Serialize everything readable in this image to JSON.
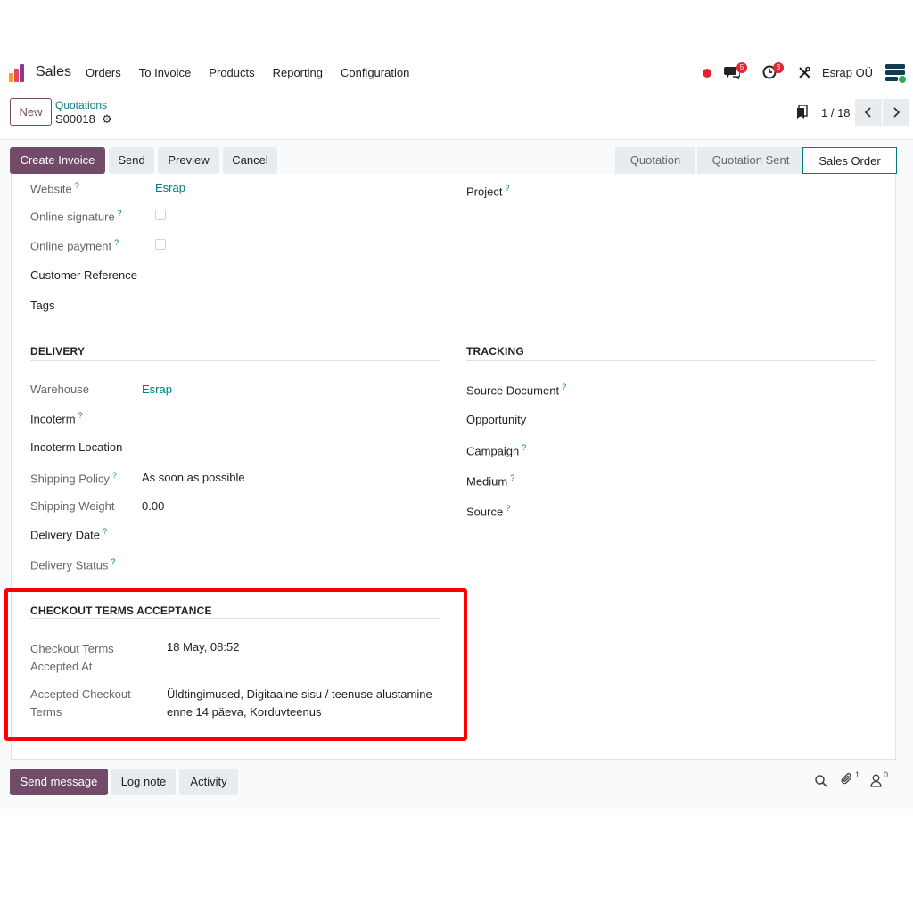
{
  "navbar": {
    "app_name": "Sales",
    "menu": [
      "Orders",
      "To Invoice",
      "Products",
      "Reporting",
      "Configuration"
    ],
    "messages_count": "5",
    "activities_count": "3",
    "company": "Esrap OÜ"
  },
  "breadcrumb": {
    "new_label": "New",
    "parent": "Quotations",
    "current": "S00018"
  },
  "pager": {
    "text": "1 / 18"
  },
  "actions": {
    "create_invoice": "Create Invoice",
    "send": "Send",
    "preview": "Preview",
    "cancel": "Cancel"
  },
  "status_bar": {
    "stages": [
      "Quotation",
      "Quotation Sent",
      "Sales Order"
    ],
    "active": "Sales Order"
  },
  "form": {
    "website_label": "Website",
    "website_value": "Esrap",
    "online_signature_label": "Online signature",
    "online_payment_label": "Online payment",
    "customer_reference_label": "Customer Reference",
    "tags_label": "Tags",
    "project_label": "Project",
    "delivery": {
      "title": "DELIVERY",
      "warehouse_label": "Warehouse",
      "warehouse_value": "Esrap",
      "incoterm_label": "Incoterm",
      "incoterm_location_label": "Incoterm Location",
      "shipping_policy_label": "Shipping Policy",
      "shipping_policy_value": "As soon as possible",
      "shipping_weight_label": "Shipping Weight",
      "shipping_weight_value": "0.00",
      "delivery_date_label": "Delivery Date",
      "delivery_status_label": "Delivery Status"
    },
    "tracking": {
      "title": "TRACKING",
      "source_document_label": "Source Document",
      "opportunity_label": "Opportunity",
      "campaign_label": "Campaign",
      "medium_label": "Medium",
      "source_label": "Source"
    },
    "checkout": {
      "title": "CHECKOUT TERMS ACCEPTANCE",
      "accepted_at_label_1": "Checkout Terms",
      "accepted_at_label_2": "Accepted At",
      "accepted_at_value": "18 May, 08:52",
      "accepted_terms_label_1": "Accepted Checkout",
      "accepted_terms_label_2": "Terms",
      "accepted_terms_value_1": "Üldtingimused, Digitaalne sisu / teenuse alustamine",
      "accepted_terms_value_2": "enne 14 päeva, Korduvteenus"
    }
  },
  "chatter": {
    "send_message": "Send message",
    "log_note": "Log note",
    "activity": "Activity",
    "attachments_count": "1",
    "followers_count": "0"
  },
  "colors": {
    "brand": "#714b67",
    "link": "#017e84",
    "highlight": "#ff0000",
    "badge": "#e2242f"
  }
}
